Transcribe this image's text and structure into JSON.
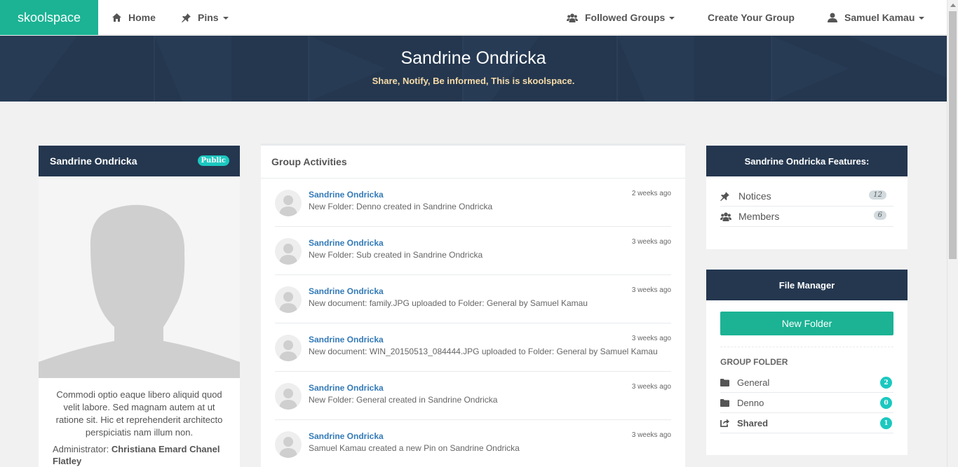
{
  "nav": {
    "brand": "skoolspace",
    "home": "Home",
    "pins": "Pins",
    "followed_groups": "Followed Groups",
    "create_group": "Create Your Group",
    "user": "Samuel Kamau"
  },
  "banner": {
    "title": "Sandrine Ondricka",
    "subtitle": "Share, Notify, Be informed, This is skoolspace."
  },
  "profile": {
    "name": "Sandrine Ondricka",
    "badge": "Public",
    "description": "Commodi optio eaque libero aliquid quod velit labore. Sed magnam autem at ut ratione sit. Hic et reprehenderit architecto perspiciatis nam illum non.",
    "admin_label": "Administrator:",
    "admin_name": "Christiana Emard Chanel Flatley"
  },
  "activities": {
    "title": "Group Activities",
    "items": [
      {
        "name": "Sandrine Ondricka",
        "text": "New Folder: Denno created in Sandrine Ondricka",
        "time": "2 weeks ago"
      },
      {
        "name": "Sandrine Ondricka",
        "text": "New Folder: Sub created in Sandrine Ondricka",
        "time": "3 weeks ago"
      },
      {
        "name": "Sandrine Ondricka",
        "text": "New document: family.JPG uploaded to Folder: General by Samuel Kamau",
        "time": "3 weeks ago"
      },
      {
        "name": "Sandrine Ondricka",
        "text": "New document: WIN_20150513_084444.JPG uploaded to Folder: General by Samuel Kamau",
        "time": "3 weeks ago"
      },
      {
        "name": "Sandrine Ondricka",
        "text": "New Folder: General created in Sandrine Ondricka",
        "time": "3 weeks ago"
      },
      {
        "name": "Sandrine Ondricka",
        "text": "Samuel Kamau created a new Pin on Sandrine Ondricka",
        "time": "3 weeks ago"
      }
    ]
  },
  "features": {
    "title": "Sandrine Ondricka Features:",
    "notices_label": "Notices",
    "notices_count": "12",
    "members_label": "Members",
    "members_count": "6"
  },
  "file_manager": {
    "title": "File Manager",
    "new_folder": "New Folder",
    "group_folder_label": "GROUP FOLDER",
    "folders": [
      {
        "label": "General",
        "count": "2"
      },
      {
        "label": "Denno",
        "count": "0"
      },
      {
        "label": "Shared",
        "count": "1"
      }
    ]
  },
  "colors": {
    "brand": "#1bb394",
    "navy": "#24374f",
    "accent_teal": "#1bc8c0",
    "link": "#337ab7"
  }
}
